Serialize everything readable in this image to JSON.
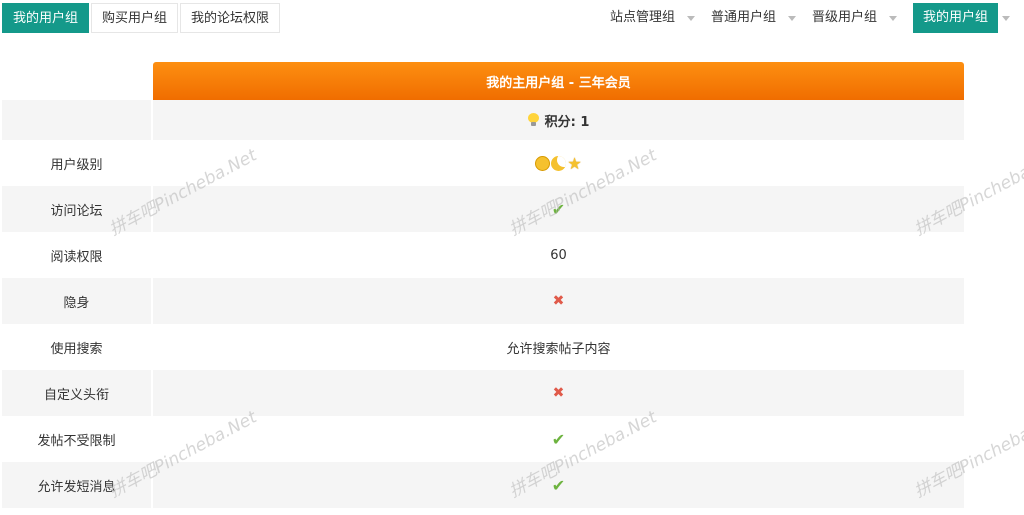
{
  "tabs_left": [
    {
      "label": "我的用户组",
      "active": true
    },
    {
      "label": "购买用户组",
      "active": false
    },
    {
      "label": "我的论坛权限",
      "active": false
    }
  ],
  "tabs_right": [
    {
      "label": "站点管理组",
      "active": false
    },
    {
      "label": "普通用户组",
      "active": false
    },
    {
      "label": "晋级用户组",
      "active": false
    },
    {
      "label": "我的用户组",
      "active": true
    }
  ],
  "table": {
    "header": "我的主用户组 - 三年会员",
    "score_label": "积分: 1",
    "rows": [
      {
        "label": "用户级别",
        "value": "",
        "icon": "level-icons"
      },
      {
        "label": "访问论坛",
        "value": "✔",
        "icon": "check-icon"
      },
      {
        "label": "阅读权限",
        "value": "60",
        "icon": ""
      },
      {
        "label": "隐身",
        "value": "✖",
        "icon": "cross-icon"
      },
      {
        "label": "使用搜索",
        "value": "允许搜索帖子内容",
        "icon": ""
      },
      {
        "label": "自定义头衔",
        "value": "✖",
        "icon": "cross-icon"
      },
      {
        "label": "发帖不受限制",
        "value": "✔",
        "icon": "check-icon"
      },
      {
        "label": "允许发短消息",
        "value": "✔",
        "icon": "check-icon"
      }
    ]
  },
  "watermark": "拼车吧Pincheba.Net",
  "colors": {
    "accent": "#14998a",
    "header_orange": "#f57d05",
    "check": "#6db33f",
    "cross": "#e05a4a"
  }
}
